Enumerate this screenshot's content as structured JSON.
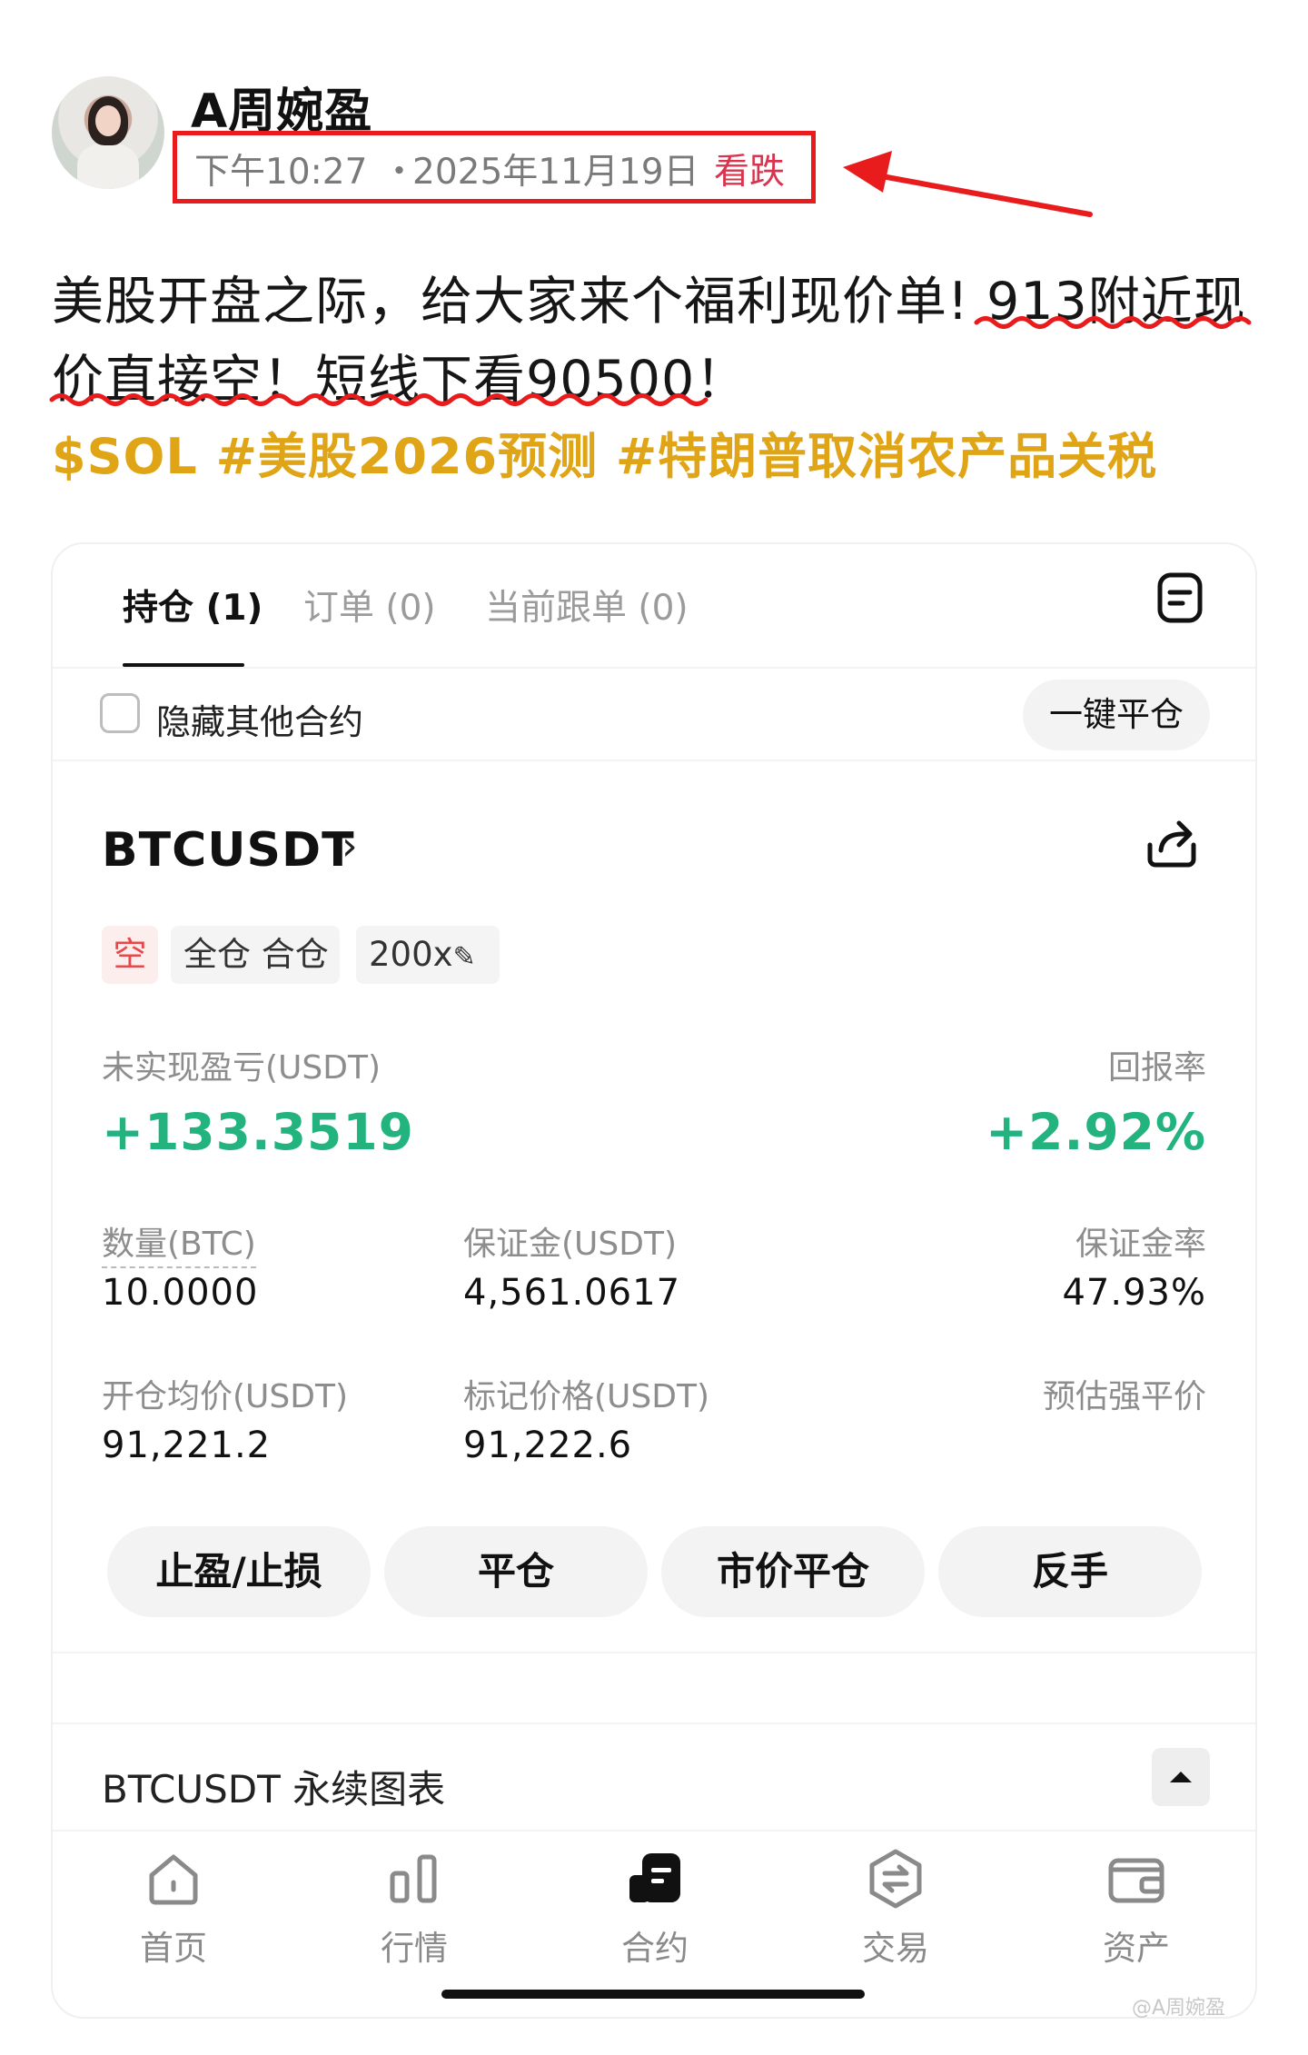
{
  "post": {
    "username": "A周婉盈",
    "time": "下午10:27",
    "separator": "・",
    "date": "2025年11月19日",
    "tag": "看跌",
    "line1": "美股开盘之际，给大家来个福利现价单! 913附近现",
    "line2": "价直接空！短线下看90500！",
    "hashtags": "$SOL #美股2026预测 #特朗普取消农产品关税"
  },
  "tabs": [
    {
      "label": "持仓 (1)",
      "active": true
    },
    {
      "label": "订单 (0)",
      "active": false
    },
    {
      "label": "当前跟单 (0)",
      "active": false
    }
  ],
  "filter": {
    "hide_label": "隐藏其他合约",
    "close_all": "一键平仓"
  },
  "position": {
    "symbol": "BTCUSDT",
    "side": "空",
    "margin_mode": "全仓 合仓",
    "leverage": "200x",
    "pnl_label": "未实现盈亏(USDT)",
    "pnl_value": "+133.3519",
    "roe_label": "回报率",
    "roe_value": "+2.92%",
    "qty_label": "数量(BTC)",
    "qty_value": "10.0000",
    "margin_label": "保证金(USDT)",
    "margin_value": "4,561.0617",
    "margin_ratio_label": "保证金率",
    "margin_ratio_value": "47.93%",
    "entry_label": "开仓均价(USDT)",
    "entry_value": "91,221.2",
    "mark_label": "标记价格(USDT)",
    "mark_value": "91,222.6",
    "liq_label": "预估强平价"
  },
  "actions": {
    "tpsl": "止盈/止损",
    "close": "平仓",
    "market_close": "市价平仓",
    "reverse": "反手"
  },
  "chart_section": {
    "title": "BTCUSDT 永续图表"
  },
  "nav": [
    {
      "label": "首页",
      "icon": "home-icon"
    },
    {
      "label": "行情",
      "icon": "market-icon"
    },
    {
      "label": "合约",
      "icon": "futures-icon"
    },
    {
      "label": "交易",
      "icon": "trade-icon"
    },
    {
      "label": "资产",
      "icon": "wallet-icon"
    }
  ],
  "watermark": "@A周婉盈",
  "colors": {
    "profit_green": "#22b37f",
    "short_red": "#e8484a",
    "hashtag_gold": "#e0a516",
    "annotation_red": "#e81c1c"
  }
}
